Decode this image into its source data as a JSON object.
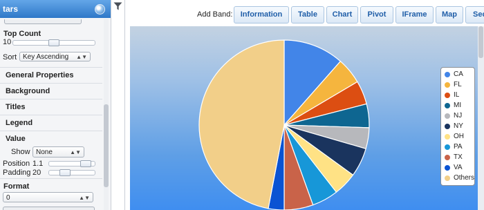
{
  "panel": {
    "title": "tars",
    "top_count": {
      "label": "Top Count",
      "value": "10",
      "slider_fraction": 0.5
    },
    "sort": {
      "label": "Sort",
      "value": "Key Ascending"
    },
    "sections": [
      "General Properties",
      "Background",
      "Titles",
      "Legend",
      "Value"
    ],
    "value_section": {
      "show_label": "Show",
      "show_value": "None",
      "position_label": "Position",
      "position_value": "1.1",
      "position_fraction": 0.9,
      "padding_label": "Padding",
      "padding_value": "20",
      "padding_fraction": 0.3
    },
    "format": {
      "label": "Format",
      "value": "0"
    }
  },
  "toolbar": {
    "add_band_label": "Add Band:",
    "buttons": [
      "Information",
      "Table",
      "Chart",
      "Pivot",
      "IFrame",
      "Map",
      "Sec"
    ]
  },
  "chart_data": {
    "type": "pie",
    "categories": [
      "CA",
      "FL",
      "IL",
      "MI",
      "NJ",
      "NY",
      "OH",
      "PA",
      "TX",
      "VA",
      "Others"
    ],
    "values": [
      11.5,
      5,
      4.5,
      4.5,
      4,
      5.5,
      4.5,
      5,
      5.5,
      3,
      47
    ],
    "colors": [
      "#4285e8",
      "#f5b53e",
      "#dc4e12",
      "#0e6691",
      "#b7b8bc",
      "#1a345e",
      "#ffe285",
      "#1797d8",
      "#c96349",
      "#0a53d3",
      "#f2cf89"
    ],
    "legend_position": "right"
  }
}
